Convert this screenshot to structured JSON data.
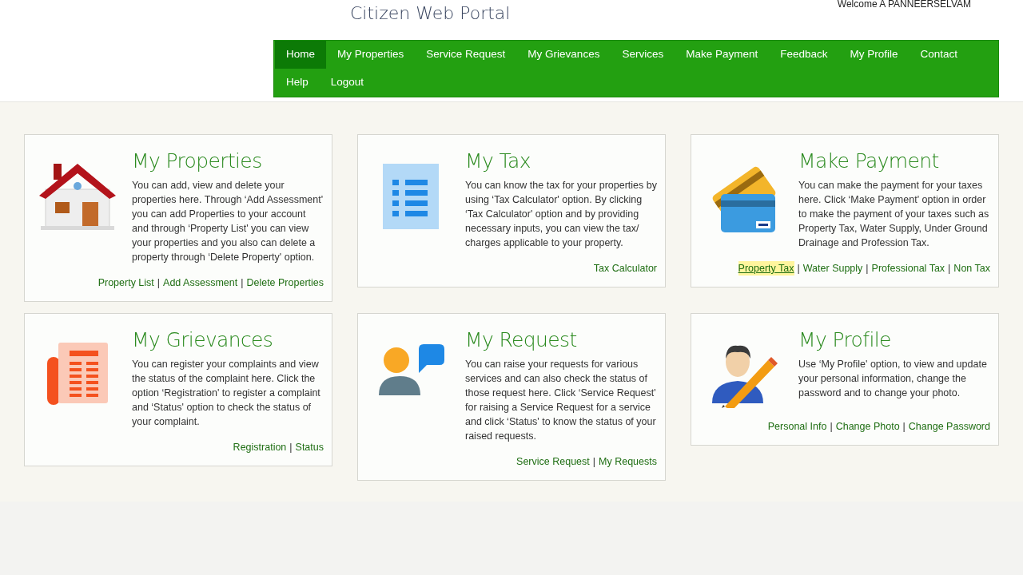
{
  "header": {
    "title": "Citizen Web Portal",
    "welcome": "Welcome A PANNEERSELVAM"
  },
  "nav": [
    {
      "label": "Home",
      "selected": true
    },
    {
      "label": "My Properties",
      "selected": false
    },
    {
      "label": "Service Request",
      "selected": false
    },
    {
      "label": "My Grievances",
      "selected": false
    },
    {
      "label": "Services",
      "selected": false
    },
    {
      "label": "Make Payment",
      "selected": false
    },
    {
      "label": "Feedback",
      "selected": false
    },
    {
      "label": "My Profile",
      "selected": false
    },
    {
      "label": "Contact",
      "selected": false
    },
    {
      "label": "Help",
      "selected": false
    },
    {
      "label": "Logout",
      "selected": false
    }
  ],
  "cards": [
    {
      "kind": "house",
      "title": "My Properties",
      "text": "You can add, view and delete your properties here. Through ‘Add Assessment' you can add Properties to your account and through ‘Property List' you can view your properties and you also can delete a property through ‘Delete Property' option.",
      "separator": "|",
      "links": [
        {
          "label": "Property List",
          "hovered": false
        },
        {
          "label": "Add Assessment",
          "hovered": false
        },
        {
          "label": "Delete Properties",
          "hovered": false
        }
      ]
    },
    {
      "kind": "list",
      "title": "My Tax",
      "text": "You can know the tax for your properties by using ‘Tax Calculator' option. By clicking ‘Tax Calculator' option and by providing necessary inputs, you can view the tax/ charges applicable to your property.",
      "links": [
        {
          "label": "Tax Calculator",
          "hovered": false
        }
      ]
    },
    {
      "kind": "cards",
      "title": "Make Payment",
      "text": "You can make the payment for your taxes here. Click ‘Make Payment' option in order to make the payment of your taxes such as Property Tax, Water Supply, Under Ground Drainage and Profession Tax.",
      "separator": "|",
      "links": [
        {
          "label": "Property Tax",
          "hovered": true
        },
        {
          "label": "Water Supply",
          "hovered": false
        },
        {
          "label": "Professional Tax",
          "hovered": false
        },
        {
          "label": "Non Tax",
          "hovered": false
        }
      ]
    },
    {
      "kind": "document",
      "title": "My Grievances",
      "text": "You can register your complaints and view the status of the complaint here. Click the option ‘Registration' to register a complaint and ‘Status' option to check the status of your complaint.",
      "separator": "|",
      "links": [
        {
          "label": "Registration",
          "hovered": false
        },
        {
          "label": "Status",
          "hovered": false
        }
      ]
    },
    {
      "kind": "chat",
      "title": "My Request",
      "text": "You can raise your requests for various services and can also check the status of those request here. Click ‘Service Request' for raising a Service Request for a service and click ‘Status' to know the status of your raised requests.",
      "separator": "|",
      "links": [
        {
          "label": "Service Request",
          "hovered": false
        },
        {
          "label": "My Requests",
          "hovered": false
        }
      ]
    },
    {
      "kind": "profile",
      "title": "My Profile",
      "text": "Use ‘My Profile' option, to view and update your personal information, change the password and to change your photo.",
      "separator": "|",
      "links": [
        {
          "label": "Personal Info",
          "hovered": false
        },
        {
          "label": "Change Photo",
          "hovered": false
        },
        {
          "label": "Change Password",
          "hovered": false
        }
      ]
    }
  ]
}
